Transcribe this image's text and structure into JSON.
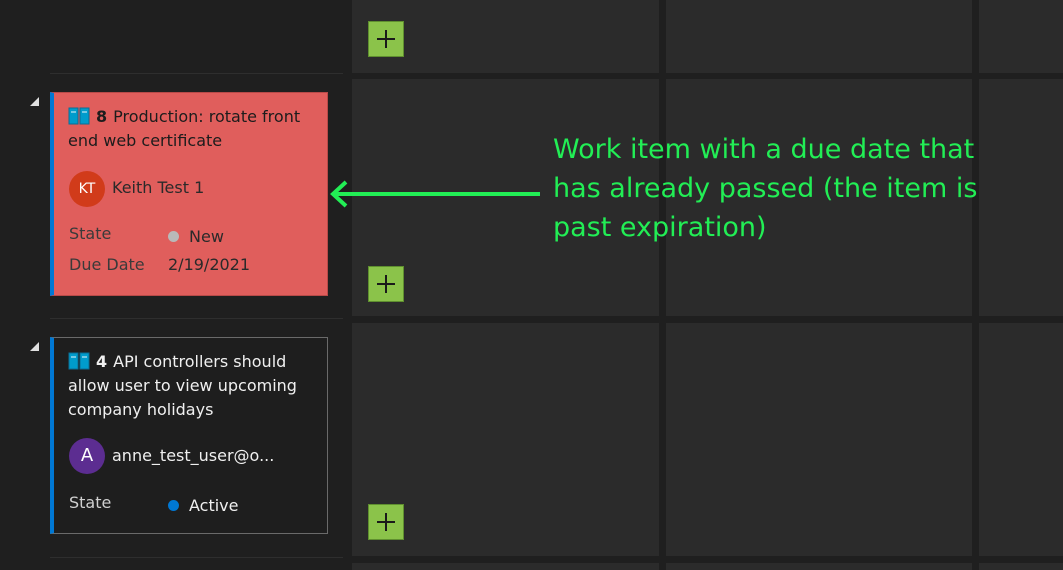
{
  "cards": [
    {
      "id": "8",
      "title": "Production: rotate front end web certificate",
      "icon": "book-icon",
      "assignee_initials": "KT",
      "assignee_name": "Keith Test 1",
      "avatar_color": "#d13b1a",
      "state_label": "State",
      "state_value": "New",
      "state_color": "#b9b9b9",
      "due_label": "Due Date",
      "due_value": "2/19/2021",
      "background": "#e05e5c"
    },
    {
      "id": "4",
      "title": "API controllers should allow user to view upcoming company holidays",
      "icon": "book-icon",
      "assignee_initials": "A",
      "assignee_name": "anne_test_user@o...",
      "avatar_color": "#5c2d91",
      "state_label": "State",
      "state_value": "Active",
      "state_color": "#0078d4"
    }
  ],
  "annotation": {
    "text": "Work item with a due date that has already passed (the item is past expiration)",
    "color": "#22ee55"
  },
  "colors": {
    "accent": "#0078d4",
    "add_button": "#8bc34a"
  }
}
